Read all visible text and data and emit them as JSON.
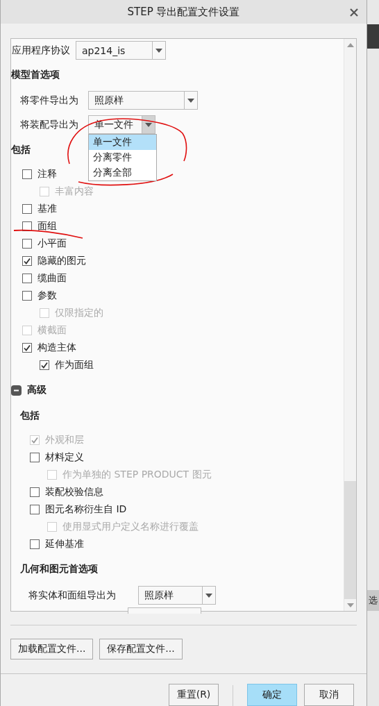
{
  "window": {
    "title": "STEP 导出配置文件设置"
  },
  "protocol": {
    "label": "应用程序协议",
    "value": "ap214_is"
  },
  "model_preferences": {
    "title": "模型首选项",
    "combos": [
      {
        "label": "将零件导出为",
        "value": "照原样",
        "open": false
      },
      {
        "label": "将装配导出为",
        "value": "单一文件",
        "open": true,
        "options": [
          {
            "label": "单一文件",
            "selected": true
          },
          {
            "label": "分离零件",
            "selected": false
          },
          {
            "label": "分离全部",
            "selected": false
          }
        ]
      }
    ]
  },
  "include": {
    "title": "包括",
    "items": [
      {
        "label": "注释",
        "checked": false,
        "disabled": false,
        "children": [
          {
            "label": "丰富内容",
            "checked": false,
            "disabled": true
          }
        ]
      },
      {
        "label": "基准",
        "checked": false,
        "disabled": false
      },
      {
        "label": "面组",
        "checked": false,
        "disabled": false
      },
      {
        "label": "小平面",
        "checked": false,
        "disabled": false
      },
      {
        "label": "隐藏的图元",
        "checked": true,
        "disabled": false
      },
      {
        "label": "缆曲面",
        "checked": false,
        "disabled": false
      },
      {
        "label": "参数",
        "checked": false,
        "disabled": false,
        "children": [
          {
            "label": "仅限指定的",
            "checked": false,
            "disabled": true
          }
        ]
      },
      {
        "label": "横截面",
        "checked": false,
        "disabled": true
      },
      {
        "label": "构造主体",
        "checked": true,
        "disabled": false,
        "children": [
          {
            "label": "作为面组",
            "checked": true,
            "disabled": false
          }
        ]
      }
    ]
  },
  "advanced": {
    "title": "高级",
    "expanded": true,
    "include": {
      "title": "包括",
      "items": [
        {
          "label": "外观和层",
          "checked": true,
          "disabled": true
        },
        {
          "label": "材料定义",
          "checked": false,
          "disabled": false,
          "children": [
            {
              "label": "作为单独的 STEP PRODUCT 图元",
              "checked": false,
              "disabled": true
            }
          ]
        },
        {
          "label": "装配校验信息",
          "checked": false,
          "disabled": false
        },
        {
          "label": "图元名称衍生自 ID",
          "checked": false,
          "disabled": false,
          "children": [
            {
              "label": "使用显式用户定义名称进行覆盖",
              "checked": false,
              "disabled": true
            }
          ]
        },
        {
          "label": "延伸基准",
          "checked": false,
          "disabled": false
        }
      ]
    },
    "geometry": {
      "title": "几何和图元首选项",
      "combos": [
        {
          "label": "将实体和面组导出为",
          "value": "照原样",
          "open": false
        }
      ]
    }
  },
  "file_buttons": [
    "加载配置文件...",
    "保存配置文件..."
  ],
  "footer_buttons": [
    {
      "label": "重置(R)",
      "selected": false
    },
    {
      "label": "确定",
      "selected": true
    },
    {
      "label": "取消",
      "selected": false
    }
  ],
  "background_app": {
    "text": "选"
  }
}
